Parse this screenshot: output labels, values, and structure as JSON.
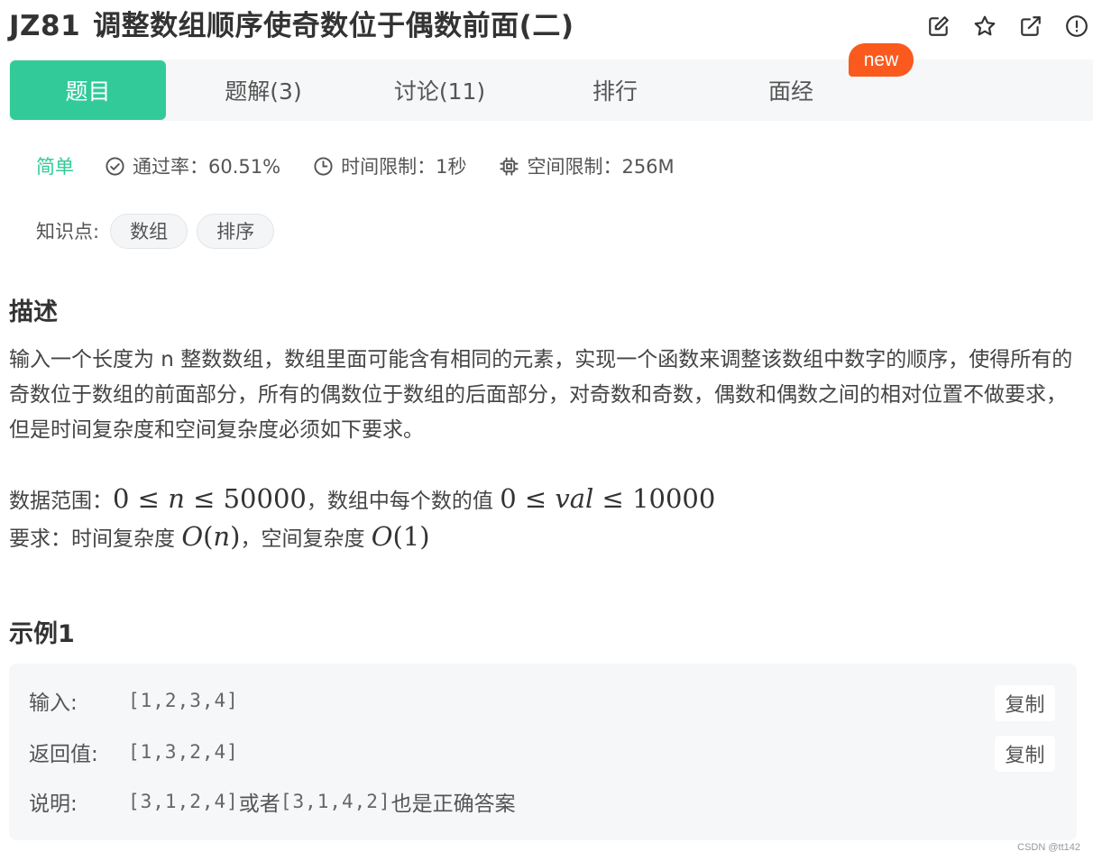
{
  "problem": {
    "code": "JZ81",
    "title": "调整数组顺序使奇数位于偶数前面(二)"
  },
  "title_icons": [
    "edit-icon",
    "star-icon",
    "external-link-icon",
    "report-icon"
  ],
  "tabs": [
    {
      "label": "题目",
      "active": true
    },
    {
      "label": "题解(3)",
      "active": false
    },
    {
      "label": "讨论(11)",
      "active": false
    },
    {
      "label": "排行",
      "active": false
    },
    {
      "label": "面经",
      "active": false
    }
  ],
  "new_badge": "new",
  "meta": {
    "difficulty": "简单",
    "pass_rate": "通过率：60.51%",
    "time_limit": "时间限制：1秒",
    "memory_limit": "空间限制：256M"
  },
  "knowledge": {
    "label": "知识点:",
    "tags": [
      "数组",
      "排序"
    ]
  },
  "description": {
    "heading": "描述",
    "text": "输入一个长度为 n 整数数组，数组里面可能含有相同的元素，实现一个函数来调整该数组中数字的顺序，使得所有的奇数位于数组的前面部分，所有的偶数位于数组的后面部分，对奇数和奇数，偶数和偶数之间的相对位置不做要求，但是时间复杂度和空间复杂度必须如下要求。",
    "range_label": "数据范围：",
    "range_mid": "，数组中每个数的值 ",
    "req_label": "要求：时间复杂度 ",
    "req_mid": "，空间复杂度 "
  },
  "example": {
    "heading": "示例1",
    "input_label": "输入:",
    "input_value": "[1,2,3,4]",
    "output_label": "返回值:",
    "output_value": "[1,3,2,4]",
    "note_label": "说明:",
    "note_value_a": "[3,1,2,4]",
    "note_text_a": "或者",
    "note_value_b": "[3,1,4,2]",
    "note_text_b": "也是正确答案",
    "copy_label": "复制"
  },
  "watermark": "CSDN @tt142"
}
